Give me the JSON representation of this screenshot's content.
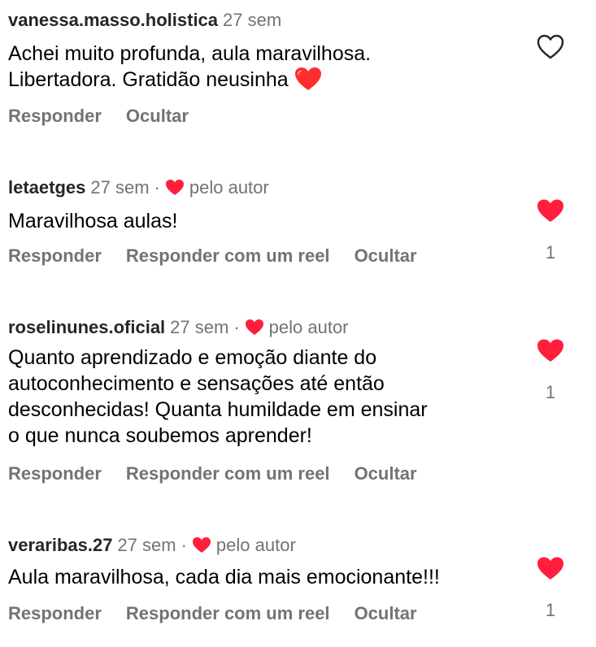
{
  "comments": [
    {
      "username": "vanessa.masso.holistica",
      "time": "27 sem",
      "text_line1": "Achei muito profunda, aula maravilhosa.",
      "text_line2": "Libertadora. Gratidão neusinha",
      "emoji": "heart-emoji",
      "actions": {
        "reply": "Responder",
        "hide": "Ocultar"
      },
      "liked": false
    },
    {
      "username": "letaetges",
      "time": "27 sem",
      "separator": "·",
      "by_author": "pelo autor",
      "text": "Maravilhosa aulas!",
      "actions": {
        "reply": "Responder",
        "reply_reel": "Responder com um reel",
        "hide": "Ocultar"
      },
      "liked": true,
      "likes": "1"
    },
    {
      "username": "roselinunes.oficial",
      "time": "27 sem",
      "separator": "·",
      "by_author": "pelo autor",
      "text_lines": [
        "Quanto aprendizado e emoção diante do",
        "autoconhecimento e sensações até então",
        "desconhecidas! Quanta humildade em ensinar",
        "o que nunca soubemos aprender!"
      ],
      "actions": {
        "reply": "Responder",
        "reply_reel": "Responder com um reel",
        "hide": "Ocultar"
      },
      "liked": true,
      "likes": "1"
    },
    {
      "username": "veraribas.27",
      "time": "27 sem",
      "separator": "·",
      "by_author": "pelo autor",
      "text": "Aula maravilhosa, cada dia mais emocionante!!!",
      "actions": {
        "reply": "Responder",
        "reply_reel": "Responder com um reel",
        "hide": "Ocultar"
      },
      "liked": true,
      "likes": "1"
    }
  ],
  "colors": {
    "like_red": "#ff3040",
    "muted_gray": "#737373",
    "outline_gray": "#262626"
  }
}
